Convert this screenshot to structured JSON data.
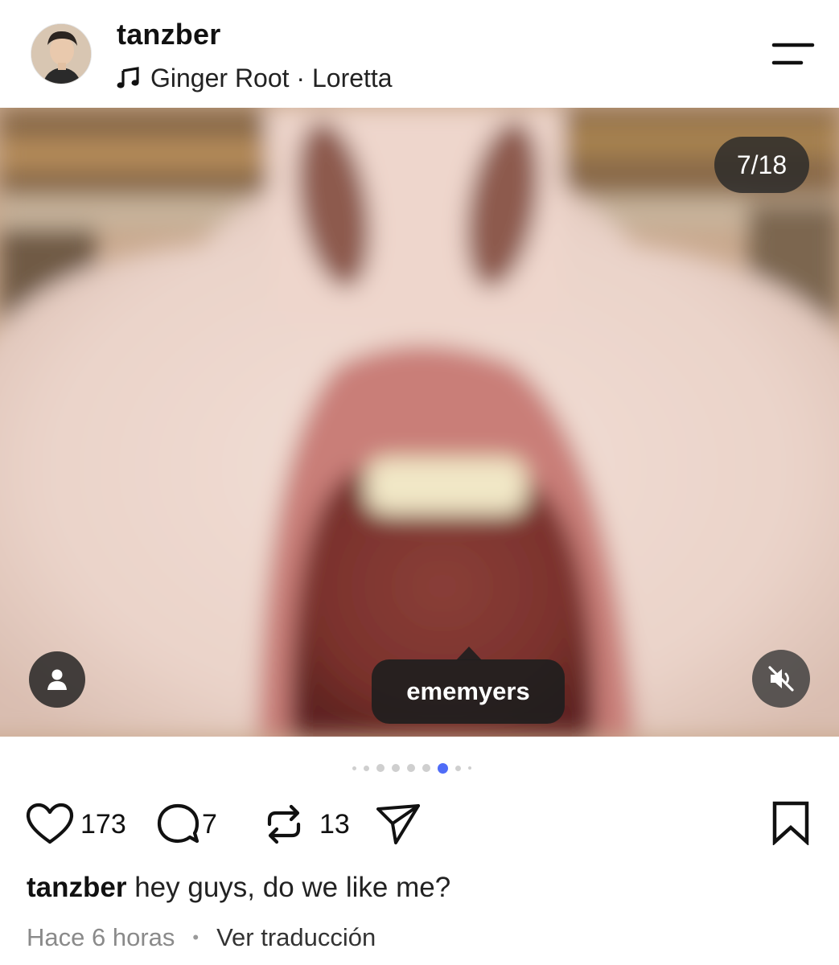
{
  "post": {
    "username": "tanzber",
    "music": {
      "icon": "music-note-icon",
      "track": "Ginger Root · Loretta"
    },
    "menu_icon": "menu-icon"
  },
  "media": {
    "counter": "7/18",
    "current_index": 7,
    "total": 18,
    "tag_username": "ememyers",
    "user_tag_icon": "person-icon",
    "mute_icon": "muted-speaker-icon"
  },
  "carousel": {
    "dot_count": 9,
    "active_dot": 7,
    "active_color": "#4f6cf7"
  },
  "actions": {
    "likes": "173",
    "comments": "7",
    "reposts": "13"
  },
  "caption": {
    "username": "tanzber",
    "text": "hey guys, do we like me?"
  },
  "meta": {
    "time": "Hace 6 horas",
    "separator": "•",
    "translate": "Ver traducción"
  }
}
